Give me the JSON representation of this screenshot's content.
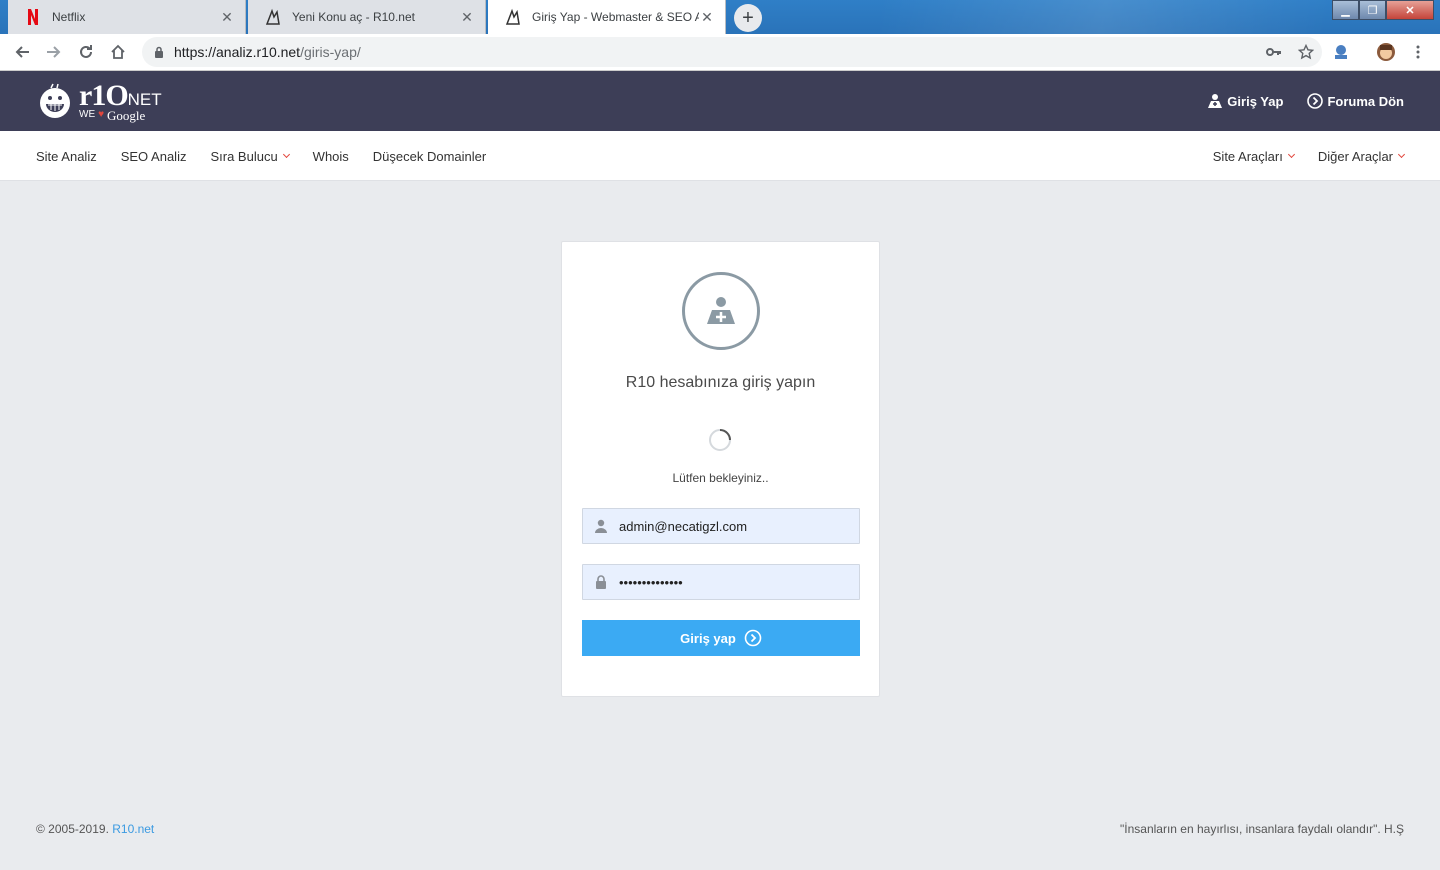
{
  "browser": {
    "tabs": [
      {
        "title": "Netflix",
        "icon": "netflix-icon"
      },
      {
        "title": "Yeni Konu aç - R10.net",
        "icon": "r10-icon"
      },
      {
        "title": "Giriş Yap - Webmaster & SEO Ar",
        "icon": "r10-icon"
      }
    ],
    "address": {
      "host": "https://analiz.r10.net",
      "path": "/giris-yap/"
    }
  },
  "header": {
    "brand": {
      "main": "r1O",
      "suffix": "NET",
      "sub_we": "WE",
      "sub_google": "Google"
    },
    "links": [
      {
        "label": "Giriş Yap",
        "icon": "user-icon"
      },
      {
        "label": "Foruma Dön",
        "icon": "arrow-circle-icon"
      }
    ]
  },
  "nav": {
    "left": [
      {
        "label": "Site Analiz"
      },
      {
        "label": "SEO Analiz"
      },
      {
        "label": "Sıra Bulucu",
        "dropdown": true
      },
      {
        "label": "Whois"
      },
      {
        "label": "Düşecek Domainler"
      }
    ],
    "right": [
      {
        "label": "Site Araçları",
        "dropdown": true
      },
      {
        "label": "Diğer Araçlar",
        "dropdown": true
      }
    ]
  },
  "login": {
    "title": "R10 hesabınıza giriş yapın",
    "wait_text": "Lütfen bekleyiniz..",
    "email_value": "admin@necatigzl.com",
    "password_value": "••••••••••••••",
    "button_label": "Giriş yap"
  },
  "footer": {
    "copyright": "© 2005-2019. ",
    "site_link": "R10.net",
    "quote": "\"İnsanların en hayırlısı, insanlara faydalı olandır\". H.Ş"
  },
  "colors": {
    "header_bg": "#3d3e57",
    "accent_blue": "#3baaf3",
    "chevron_red": "#e2463c",
    "page_bg": "#e9ebee"
  }
}
